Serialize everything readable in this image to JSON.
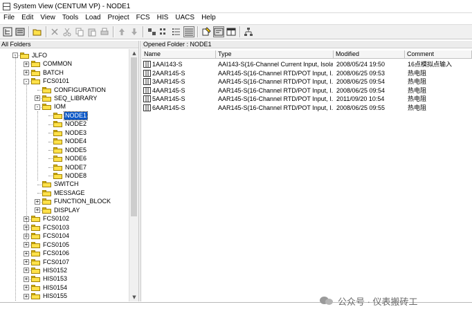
{
  "window": {
    "title": "System View (CENTUM VP) - NODE1"
  },
  "menu": [
    "File",
    "Edit",
    "View",
    "Tools",
    "Load",
    "Project",
    "FCS",
    "HIS",
    "UACS",
    "Help"
  ],
  "toolbar": {
    "buttons": [
      {
        "icon": "tree-view-icon",
        "pressed": false
      },
      {
        "icon": "list-view-icon",
        "pressed": false
      },
      {
        "sep": true
      },
      {
        "icon": "open-folder-icon",
        "pressed": false
      },
      {
        "sep": true
      },
      {
        "icon": "delete-icon",
        "pressed": false
      },
      {
        "icon": "cut-icon",
        "pressed": false
      },
      {
        "icon": "copy-icon",
        "pressed": false
      },
      {
        "icon": "paste-icon",
        "pressed": false
      },
      {
        "icon": "print-icon",
        "pressed": false
      },
      {
        "sep": true
      },
      {
        "icon": "up-arrow-icon",
        "pressed": false
      },
      {
        "icon": "down-arrow-icon",
        "pressed": false
      },
      {
        "sep": true
      },
      {
        "icon": "large-icons-icon",
        "pressed": false
      },
      {
        "icon": "small-icons-icon",
        "pressed": false
      },
      {
        "icon": "list-icon",
        "pressed": false
      },
      {
        "icon": "details-icon",
        "pressed": true
      },
      {
        "sep": true
      },
      {
        "icon": "properties-icon",
        "pressed": false
      },
      {
        "icon": "config-icon",
        "pressed": true
      },
      {
        "icon": "window-icon",
        "pressed": false
      },
      {
        "sep": true
      },
      {
        "icon": "network-icon",
        "pressed": false
      }
    ]
  },
  "left_pane": {
    "header": "All Folders",
    "tree": [
      {
        "label": "JLFO",
        "level": 1,
        "expander": "-"
      },
      {
        "label": "COMMON",
        "level": 2,
        "expander": "+"
      },
      {
        "label": "BATCH",
        "level": 2,
        "expander": "+"
      },
      {
        "label": "FCS0101",
        "level": 2,
        "expander": "-"
      },
      {
        "label": "CONFIGURATION",
        "level": 3,
        "expander": ""
      },
      {
        "label": "SEQ_LIBRARY",
        "level": 3,
        "expander": "+"
      },
      {
        "label": "IOM",
        "level": 3,
        "expander": "-"
      },
      {
        "label": "NODE1",
        "level": 4,
        "expander": "",
        "selected": true
      },
      {
        "label": "NODE2",
        "level": 4,
        "expander": ""
      },
      {
        "label": "NODE3",
        "level": 4,
        "expander": ""
      },
      {
        "label": "NODE4",
        "level": 4,
        "expander": ""
      },
      {
        "label": "NODE5",
        "level": 4,
        "expander": ""
      },
      {
        "label": "NODE6",
        "level": 4,
        "expander": ""
      },
      {
        "label": "NODE7",
        "level": 4,
        "expander": ""
      },
      {
        "label": "NODE8",
        "level": 4,
        "expander": ""
      },
      {
        "label": "SWITCH",
        "level": 3,
        "expander": ""
      },
      {
        "label": "MESSAGE",
        "level": 3,
        "expander": ""
      },
      {
        "label": "FUNCTION_BLOCK",
        "level": 3,
        "expander": "+"
      },
      {
        "label": "DISPLAY",
        "level": 3,
        "expander": "+"
      },
      {
        "label": "FCS0102",
        "level": 2,
        "expander": "+"
      },
      {
        "label": "FCS0103",
        "level": 2,
        "expander": "+"
      },
      {
        "label": "FCS0104",
        "level": 2,
        "expander": "+"
      },
      {
        "label": "FCS0105",
        "level": 2,
        "expander": "+"
      },
      {
        "label": "FCS0106",
        "level": 2,
        "expander": "+"
      },
      {
        "label": "FCS0107",
        "level": 2,
        "expander": "+"
      },
      {
        "label": "HIS0152",
        "level": 2,
        "expander": "+"
      },
      {
        "label": "HIS0153",
        "level": 2,
        "expander": "+"
      },
      {
        "label": "HIS0154",
        "level": 2,
        "expander": "+"
      },
      {
        "label": "HIS0155",
        "level": 2,
        "expander": "+"
      }
    ]
  },
  "right_pane": {
    "header": "Opened Folder : NODE1",
    "columns": [
      "Name",
      "Type",
      "Modified",
      "Comment"
    ],
    "rows": [
      {
        "name": "1AAI143-S",
        "type": "AAI143-S(16-Channel Current Input, Isola",
        "modified": "2008/05/24 19:50",
        "comment": "16点模拟点输入"
      },
      {
        "name": "2AAR145-S",
        "type": "AAR145-S(16-Channel RTD/POT Input, I...",
        "modified": "2008/06/25 09:53",
        "comment": "热电阻"
      },
      {
        "name": "3AAR145-S",
        "type": "AAR145-S(16-Channel RTD/POT Input, I...",
        "modified": "2008/06/25 09:54",
        "comment": "热电阻"
      },
      {
        "name": "4AAR145-S",
        "type": "AAR145-S(16-Channel RTD/POT Input, I...",
        "modified": "2008/06/25 09:54",
        "comment": "热电阻"
      },
      {
        "name": "5AAR145-S",
        "type": "AAR145-S(16-Channel RTD/POT Input, I...",
        "modified": "2011/09/20 10:54",
        "comment": "热电阻"
      },
      {
        "name": "6AAR145-S",
        "type": "AAR145-S(16-Channel RTD/POT Input, I...",
        "modified": "2008/06/25 09:55",
        "comment": "热电阻"
      }
    ]
  },
  "watermark": "公众号 · 仪表搬砖工",
  "colors": {
    "selection": "#0a58c8",
    "folder": "#ffe14a",
    "toolbar_bg": "#f0f0f0"
  }
}
